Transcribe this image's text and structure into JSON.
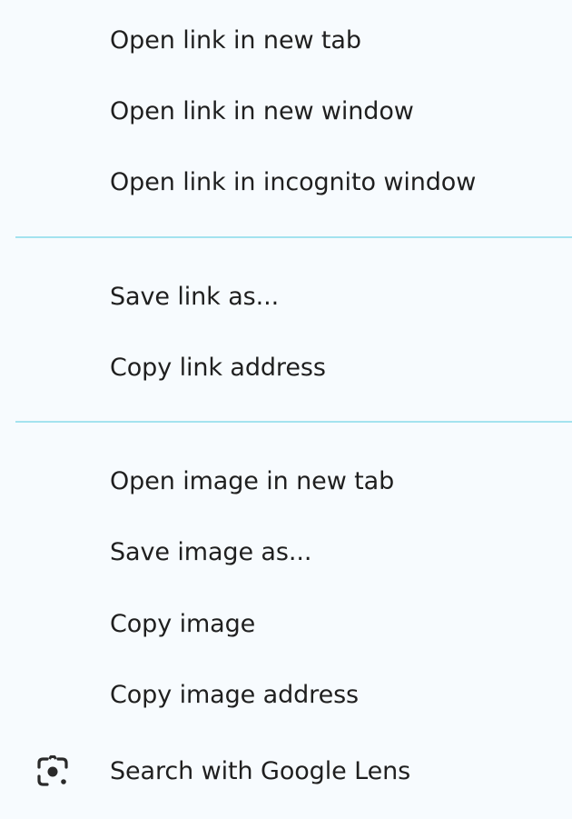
{
  "context_menu": {
    "groups": [
      {
        "items": [
          {
            "label": "Open link in new tab"
          },
          {
            "label": "Open link in new window"
          },
          {
            "label": "Open link in incognito window"
          }
        ]
      },
      {
        "items": [
          {
            "label": "Save link as..."
          },
          {
            "label": "Copy link address"
          }
        ]
      },
      {
        "items": [
          {
            "label": "Open image in new tab"
          },
          {
            "label": "Save image as..."
          },
          {
            "label": "Copy image"
          },
          {
            "label": "Copy image address"
          },
          {
            "label": "Search with Google Lens",
            "icon": "google-lens-icon"
          }
        ]
      }
    ]
  }
}
